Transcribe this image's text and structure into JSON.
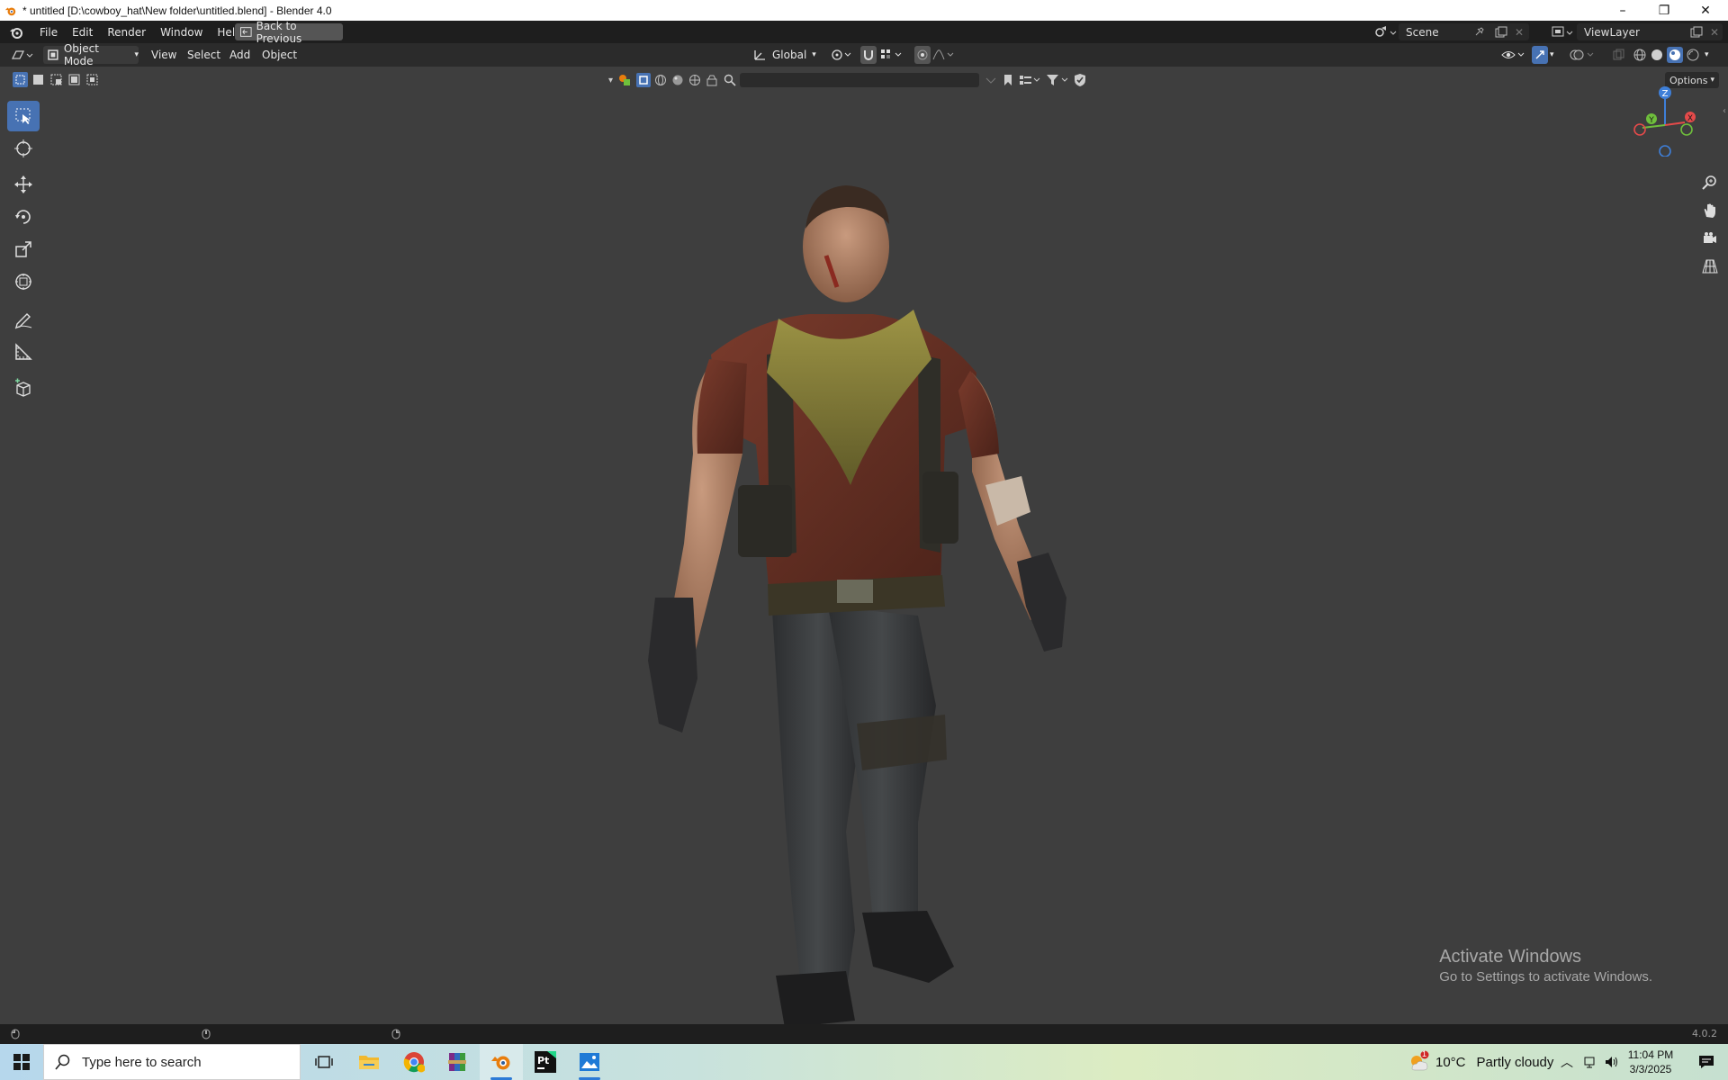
{
  "window": {
    "title": "* untitled [D:\\cowboy_hat\\New folder\\untitled.blend] - Blender 4.0",
    "minimize": "–",
    "restore": "❐",
    "close": "✕"
  },
  "topbar": {
    "menus": [
      "File",
      "Edit",
      "Render",
      "Window",
      "Help"
    ],
    "back_button": "Back to Previous",
    "scene_name": "Scene",
    "view_layer": "ViewLayer"
  },
  "viewport_header": {
    "mode": "Object Mode",
    "menus": [
      "View",
      "Select",
      "Add",
      "Object"
    ],
    "transform_orientation": "Global",
    "options": "Options"
  },
  "viewport": {
    "gizmo_axes": [
      "Z",
      "Y",
      "X"
    ],
    "watermark_line1": "Activate Windows",
    "watermark_line2": "Go to Settings to activate Windows."
  },
  "statusbar": {
    "version": "4.0.2"
  },
  "taskbar": {
    "search_placeholder": "Type here to search",
    "weather_temp": "10°C",
    "weather_text": "Partly cloudy",
    "time": "11:04 PM",
    "date": "3/3/2025",
    "weather_badge": "1"
  },
  "colors": {
    "accent": "#4772b3",
    "axis_x": "#e54a4a",
    "axis_y": "#6fbf3c",
    "axis_z": "#3e7fd8"
  }
}
